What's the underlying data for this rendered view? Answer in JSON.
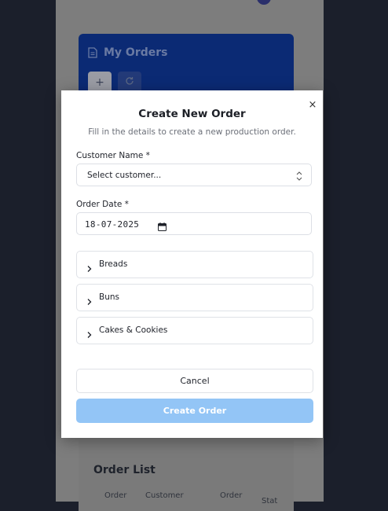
{
  "background": {
    "orders_card": {
      "title": "My Orders",
      "add_button": "+",
      "refresh_icon": "refresh-icon",
      "doc_icon": "document-icon"
    },
    "order_list": {
      "title": "Order List",
      "headers": [
        "Order",
        "Customer",
        "Order",
        "Stat"
      ]
    }
  },
  "modal": {
    "title": "Create New Order",
    "subtitle": "Fill in the details to create a new production order.",
    "close_label": "×",
    "customer": {
      "label": "Customer Name *",
      "value": "Select customer..."
    },
    "order_date": {
      "label": "Order Date *",
      "value": "18-07-2025"
    },
    "categories": [
      {
        "label": "Breads"
      },
      {
        "label": "Buns"
      },
      {
        "label": "Cakes & Cookies"
      }
    ],
    "cancel_label": "Cancel",
    "create_label": "Create Order"
  },
  "colors": {
    "page_bg": "#1b1f2b",
    "overlay_app": "#7d7d7d",
    "orders_card": "#0b2a74",
    "create_button": "#93c5f6",
    "modal_bg": "#ffffff"
  }
}
